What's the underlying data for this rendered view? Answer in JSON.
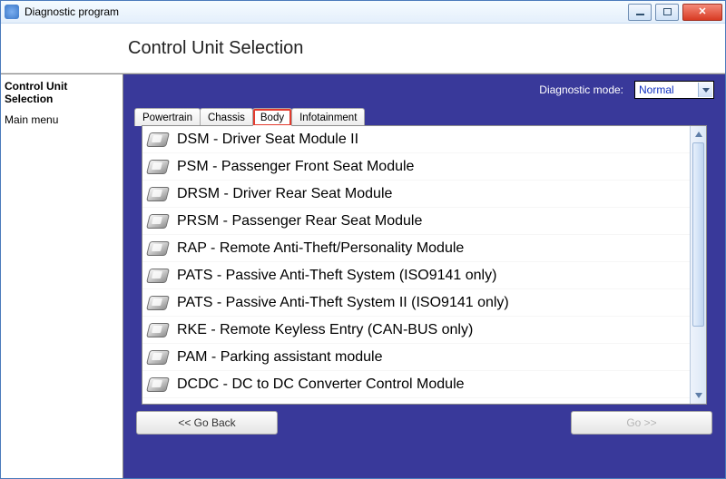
{
  "window": {
    "title": "Diagnostic program"
  },
  "header": {
    "title": "Control Unit Selection"
  },
  "sidebar": {
    "items": [
      {
        "label": "Control Unit Selection",
        "bold": true
      },
      {
        "label": "Main menu",
        "bold": false
      }
    ]
  },
  "diag_mode": {
    "label": "Diagnostic mode:",
    "value": "Normal"
  },
  "tabs": [
    {
      "label": "Powertrain",
      "active": false
    },
    {
      "label": "Chassis",
      "active": false
    },
    {
      "label": "Body",
      "active": true
    },
    {
      "label": "Infotainment",
      "active": false
    }
  ],
  "units": [
    {
      "label": "DSM - Driver Seat Module II"
    },
    {
      "label": "PSM - Passenger Front Seat Module"
    },
    {
      "label": "DRSM - Driver Rear Seat Module"
    },
    {
      "label": "PRSM - Passenger Rear Seat Module"
    },
    {
      "label": "RAP - Remote Anti-Theft/Personality Module"
    },
    {
      "label": "PATS - Passive Anti-Theft System (ISO9141 only)"
    },
    {
      "label": "PATS - Passive Anti-Theft System II (ISO9141 only)"
    },
    {
      "label": "RKE - Remote Keyless Entry (CAN-BUS only)"
    },
    {
      "label": "PAM - Parking assistant module"
    },
    {
      "label": "DCDC - DC to DC Converter Control Module"
    }
  ],
  "buttons": {
    "back": "<< Go Back",
    "go": "Go >>"
  }
}
